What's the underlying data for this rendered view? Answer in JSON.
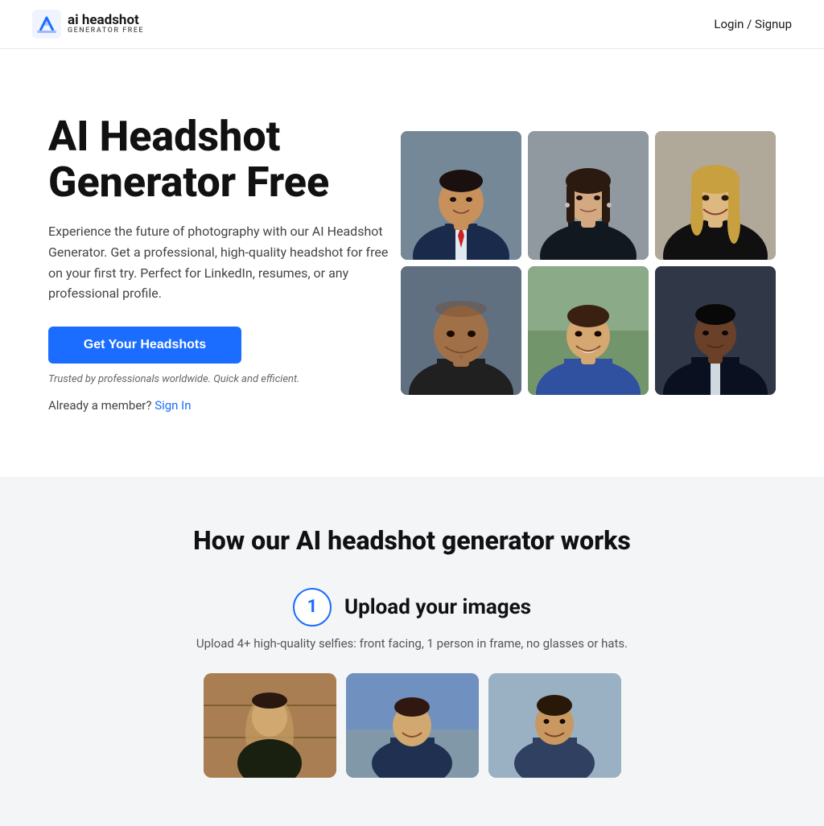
{
  "header": {
    "logo_main": "ai headshot",
    "logo_sub": "GENERATOR FREE",
    "nav_login": "Login / Signup"
  },
  "hero": {
    "title": "AI Headshot Generator Free",
    "description": "Experience the future of photography with our AI Headshot Generator. Get a professional, high-quality headshot for free on your first try. Perfect for LinkedIn, resumes, or any professional profile.",
    "cta_label": "Get Your Headshots",
    "trusted_text": "Trusted by professionals worldwide. Quick and efficient.",
    "member_text": "Already a member?",
    "signin_label": "Sign In"
  },
  "headshots": {
    "photos": [
      {
        "id": 1,
        "alt": "Man in suit with red tie"
      },
      {
        "id": 2,
        "alt": "Woman with dark hair"
      },
      {
        "id": 3,
        "alt": "Woman with blonde hair smiling"
      },
      {
        "id": 4,
        "alt": "Bald man serious expression"
      },
      {
        "id": 5,
        "alt": "Young man smiling outdoors"
      },
      {
        "id": 6,
        "alt": "Black man in suit"
      }
    ]
  },
  "how_section": {
    "title": "How our AI headshot generator works",
    "step1": {
      "number": "1",
      "label": "Upload your images",
      "description": "Upload 4+ high-quality selfies: front facing, 1 person in frame, no glasses or hats."
    }
  }
}
